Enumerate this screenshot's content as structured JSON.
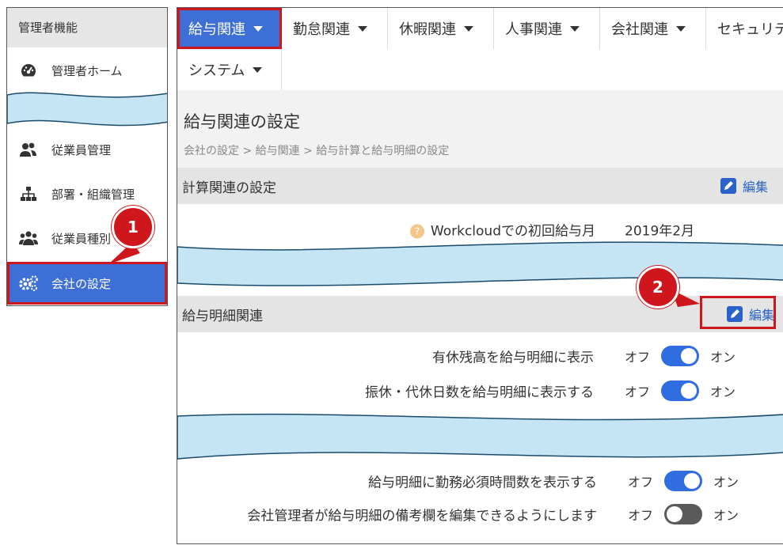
{
  "sidebar": {
    "header": "管理者機能",
    "items": [
      {
        "label": "管理者ホーム",
        "icon": "dashboard-icon"
      },
      {
        "label": "従業員管理",
        "icon": "users-icon"
      },
      {
        "label": "部署・組織管理",
        "icon": "org-chart-icon"
      },
      {
        "label": "従業員種別",
        "icon": "group-icon"
      },
      {
        "label": "会社の設定",
        "icon": "gears-icon"
      }
    ]
  },
  "nav": {
    "row1": [
      {
        "label": "給与関連"
      },
      {
        "label": "勤怠関連"
      },
      {
        "label": "休暇関連"
      },
      {
        "label": "人事関連"
      },
      {
        "label": "会社関連"
      },
      {
        "label": "セキュリテ"
      }
    ],
    "row2": [
      {
        "label": "システム"
      }
    ]
  },
  "page": {
    "title": "給与関連の設定",
    "breadcrumb": "会社の設定 > 給与関連 > 給与計算と給与明細の設定"
  },
  "sections": {
    "calc": {
      "title": "計算関連の設定",
      "edit_label": "編集",
      "rows": [
        {
          "label": "Workcloudでの初回給与月",
          "value": "2019年2月"
        }
      ]
    },
    "payslip": {
      "title": "給与明細関連",
      "edit_label": "編集",
      "rows": [
        {
          "label": "有休残高を給与明細に表示",
          "off": "オフ",
          "on": "オン",
          "state": "on"
        },
        {
          "label": "振休・代休日数を給与明細に表示する",
          "off": "オフ",
          "on": "オン",
          "state": "on"
        },
        {
          "label": "給与明細に勤務必須時間数を表示する",
          "off": "オフ",
          "on": "オン",
          "state": "on"
        },
        {
          "label": "会社管理者が給与明細の備考欄を編集できるようにします",
          "off": "オフ",
          "on": "オン",
          "state": "off"
        }
      ]
    }
  },
  "callouts": {
    "one": "1",
    "two": "2"
  },
  "colors": {
    "accent": "#3d6fd6",
    "highlight": "#d0161d",
    "toggle_on": "#2f6de0",
    "toggle_off": "#5a5a5a",
    "wave": "#c5e5f5"
  }
}
